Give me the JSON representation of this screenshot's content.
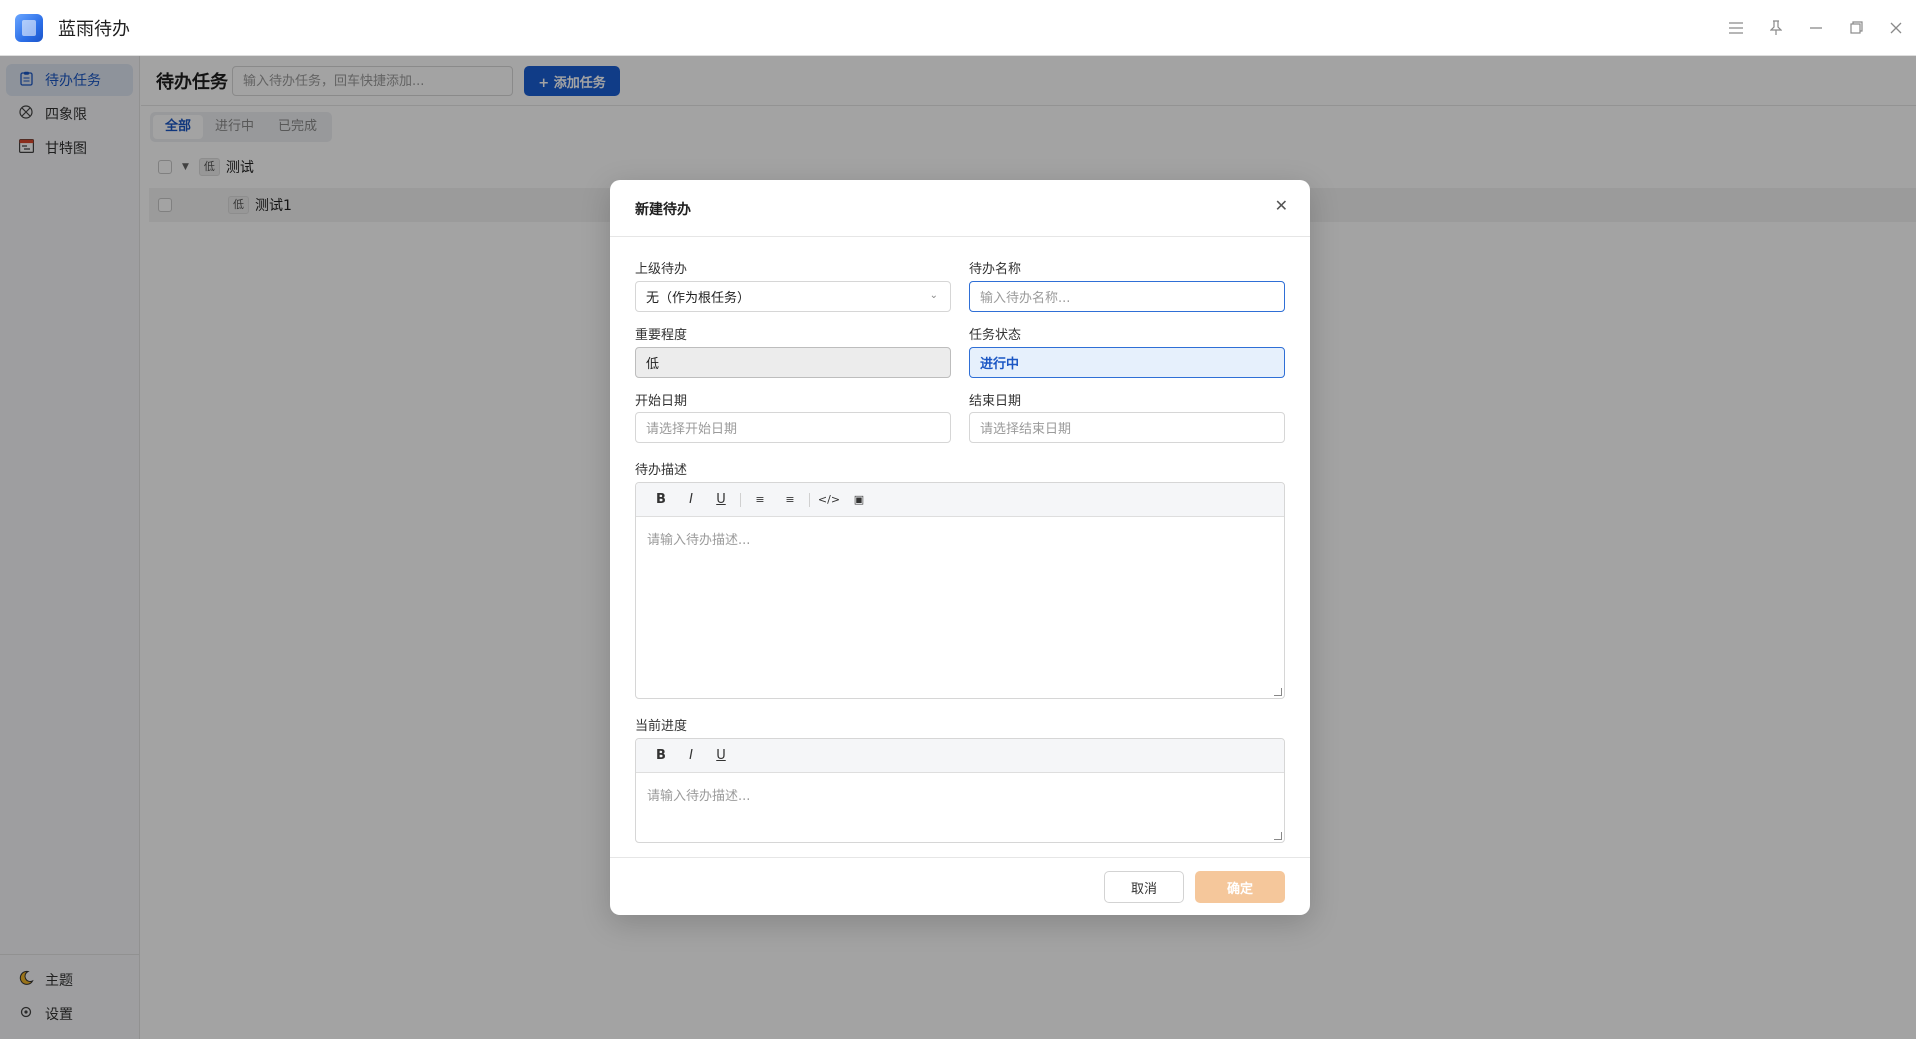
{
  "app": {
    "title": "蓝雨待办",
    "logo_icon": "notebook-app-icon",
    "accent_color": "#1a5fd4"
  },
  "window_controls": [
    "menu-icon",
    "pin-icon",
    "minimize-icon",
    "restore-icon",
    "close-icon"
  ],
  "sidebar": {
    "items": [
      {
        "label": "待办任务",
        "icon": "clipboard-icon",
        "active": true
      },
      {
        "label": "四象限",
        "icon": "quadrant-icon",
        "active": false
      },
      {
        "label": "甘特图",
        "icon": "gantt-icon",
        "active": false
      }
    ],
    "bottom": [
      {
        "label": "主题",
        "icon": "moon-icon"
      },
      {
        "label": "设置",
        "icon": "gear-icon"
      }
    ]
  },
  "main": {
    "title": "待办任务",
    "quick_add_placeholder": "输入待办任务，回车快捷添加...",
    "add_button": "+ 添加任务",
    "tabs": [
      {
        "label": "全部",
        "active": true
      },
      {
        "label": "进行中",
        "active": false
      },
      {
        "label": "已完成",
        "active": false
      }
    ],
    "tasks": [
      {
        "priority": "低",
        "name": "测试",
        "expanded": true,
        "level": 0
      },
      {
        "priority": "低",
        "name": "测试1",
        "level": 1
      }
    ]
  },
  "modal": {
    "title": "新建待办",
    "fields": {
      "parent": {
        "label": "上级待办",
        "value": "无（作为根任务）"
      },
      "name": {
        "label": "待办名称",
        "placeholder": "输入待办名称..."
      },
      "priority": {
        "label": "重要程度",
        "value": "低"
      },
      "status": {
        "label": "任务状态",
        "value": "进行中"
      },
      "start_date": {
        "label": "开始日期",
        "placeholder": "请选择开始日期"
      },
      "end_date": {
        "label": "结束日期",
        "placeholder": "请选择结束日期"
      }
    },
    "description": {
      "label": "待办描述",
      "placeholder": "请输入待办描述...",
      "toolbar": [
        "B",
        "I",
        "U",
        "≡",
        "≡",
        "</>",
        "▣"
      ]
    },
    "progress": {
      "label": "当前进度",
      "placeholder": "请输入待办描述...",
      "toolbar": [
        "B",
        "I",
        "U"
      ]
    },
    "cancel": "取消",
    "confirm": "确定"
  }
}
